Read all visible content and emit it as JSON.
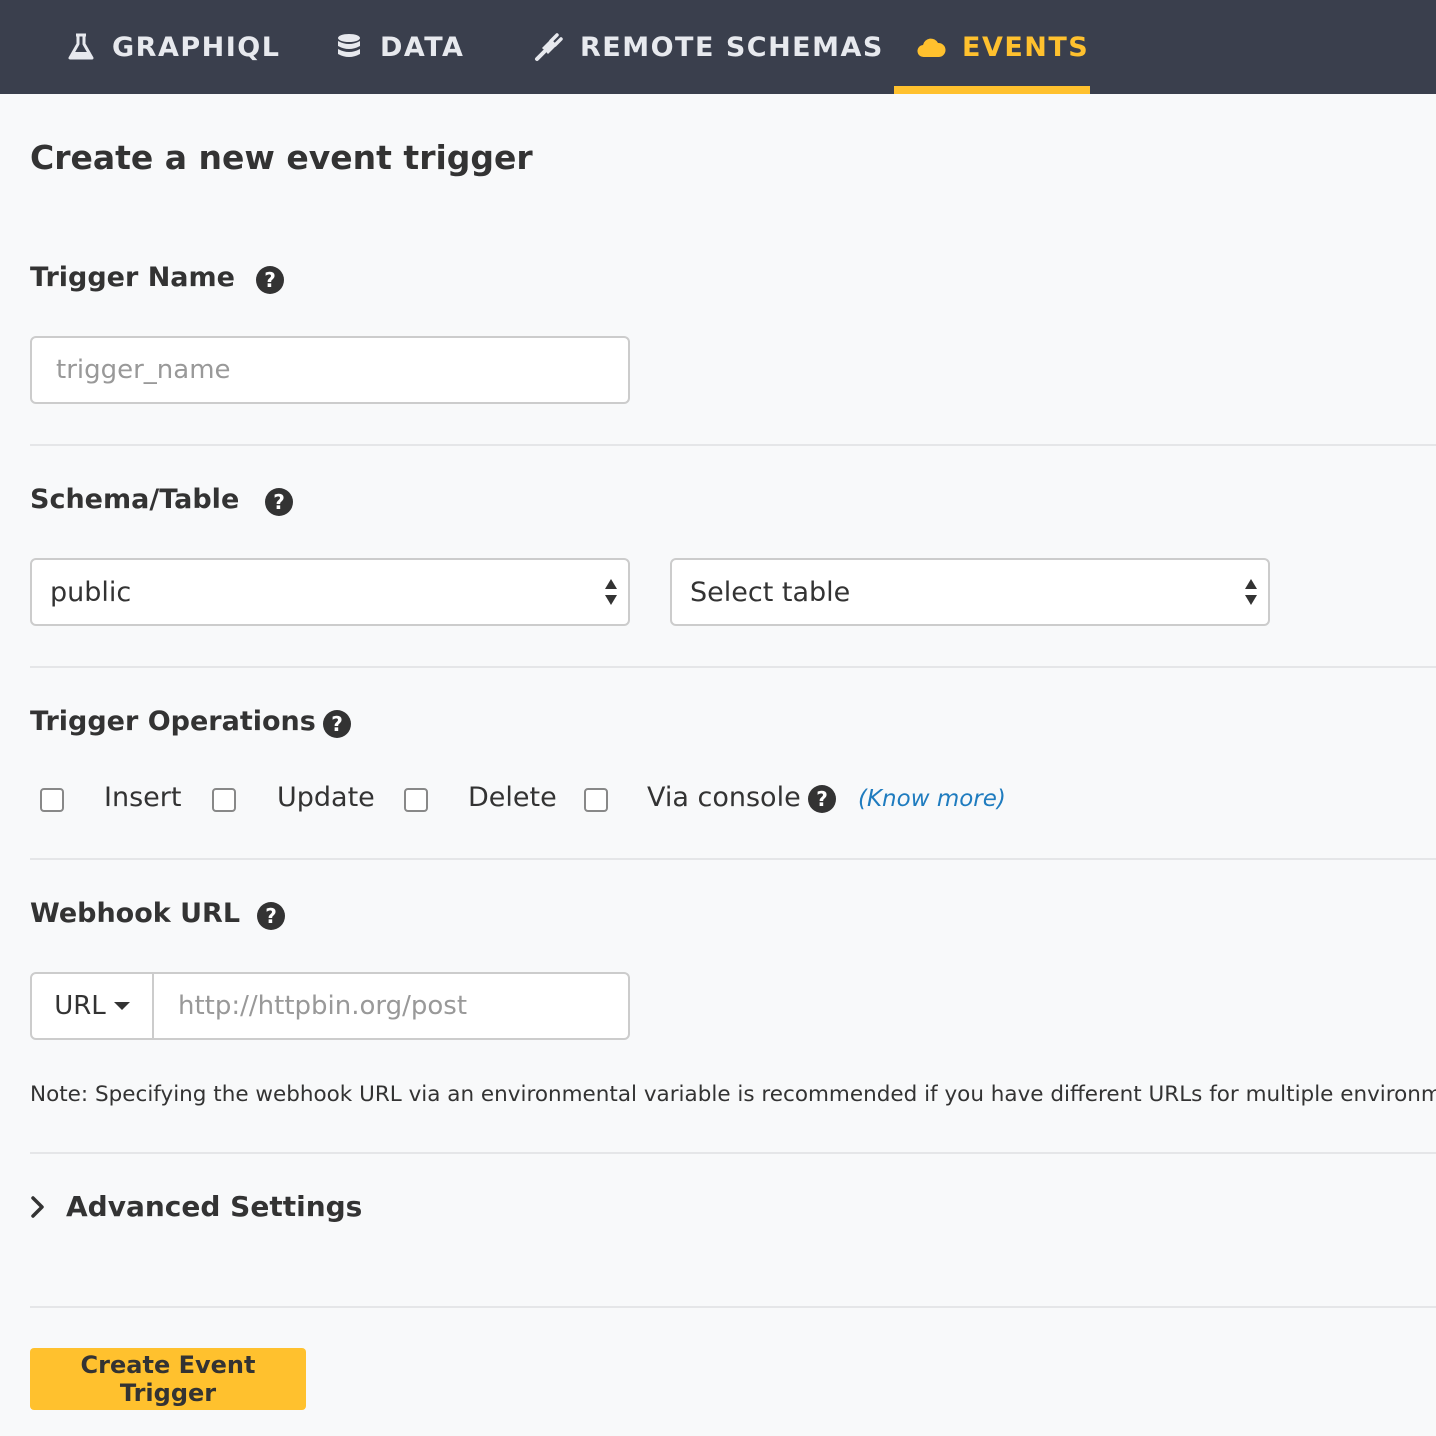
{
  "nav": {
    "tabs": [
      {
        "label": "GRAPHIQL",
        "icon": "flask-icon",
        "active": false
      },
      {
        "label": "DATA",
        "icon": "database-icon",
        "active": false
      },
      {
        "label": "REMOTE SCHEMAS",
        "icon": "plug-icon",
        "active": false
      },
      {
        "label": "EVENTS",
        "icon": "cloud-icon",
        "active": true
      }
    ]
  },
  "colors": {
    "nav_bg": "#3a3f4d",
    "accent": "#ffc12e",
    "link": "#1f7cbf"
  },
  "page": {
    "title": "Create a new event trigger"
  },
  "trigger_name": {
    "label": "Trigger Name",
    "placeholder": "trigger_name",
    "value": ""
  },
  "schema_table": {
    "label": "Schema/Table",
    "schema_value": "public",
    "table_value": "Select table"
  },
  "operations": {
    "label": "Trigger Operations",
    "items": [
      {
        "label": "Insert",
        "checked": false
      },
      {
        "label": "Update",
        "checked": false
      },
      {
        "label": "Delete",
        "checked": false
      },
      {
        "label": "Via console",
        "checked": false
      }
    ],
    "know_more": "(Know more)"
  },
  "webhook": {
    "label": "Webhook URL",
    "type_value": "URL",
    "placeholder": "http://httpbin.org/post",
    "note": "Note: Specifying the webhook URL via an environmental variable is recommended if you have different URLs for multiple environments."
  },
  "advanced": {
    "label": "Advanced Settings"
  },
  "submit": {
    "label": "Create Event Trigger"
  }
}
